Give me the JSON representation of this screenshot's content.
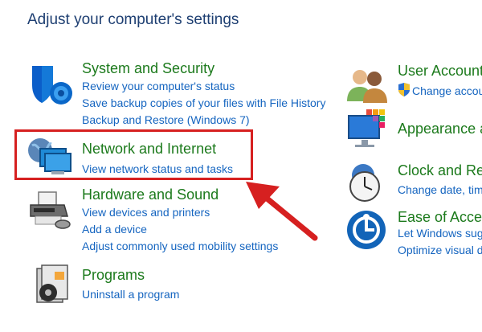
{
  "header": {
    "title": "Adjust your computer's settings"
  },
  "left_categories": [
    {
      "title": "System and Security",
      "icon": "shield-icon",
      "links": [
        "Review your computer's status",
        "Save backup copies of your files with File History",
        "Backup and Restore (Windows 7)"
      ]
    },
    {
      "title": "Network and Internet",
      "icon": "network-icon",
      "links": [
        "View network status and tasks"
      ]
    },
    {
      "title": "Hardware and Sound",
      "icon": "printer-icon",
      "links": [
        "View devices and printers",
        "Add a device",
        "Adjust commonly used mobility settings"
      ]
    },
    {
      "title": "Programs",
      "icon": "programs-icon",
      "links": [
        "Uninstall a program"
      ]
    }
  ],
  "right_categories": [
    {
      "title": "User Account",
      "icon": "users-icon",
      "links": [
        "Change accoun"
      ]
    },
    {
      "title": "Appearance a",
      "icon": "appearance-icon",
      "links": []
    },
    {
      "title": "Clock and Reg",
      "icon": "clock-icon",
      "links": [
        "Change date, time"
      ]
    },
    {
      "title": "Ease of Acces",
      "icon": "ease-of-access-icon",
      "links": [
        "Let Windows sugg",
        "Optimize visual di"
      ]
    }
  ],
  "annotations": {
    "highlight_color": "#d62020"
  },
  "colors": {
    "title_green": "#1c7a1c",
    "link_blue": "#1565c0",
    "header_blue": "#1e3f72"
  }
}
